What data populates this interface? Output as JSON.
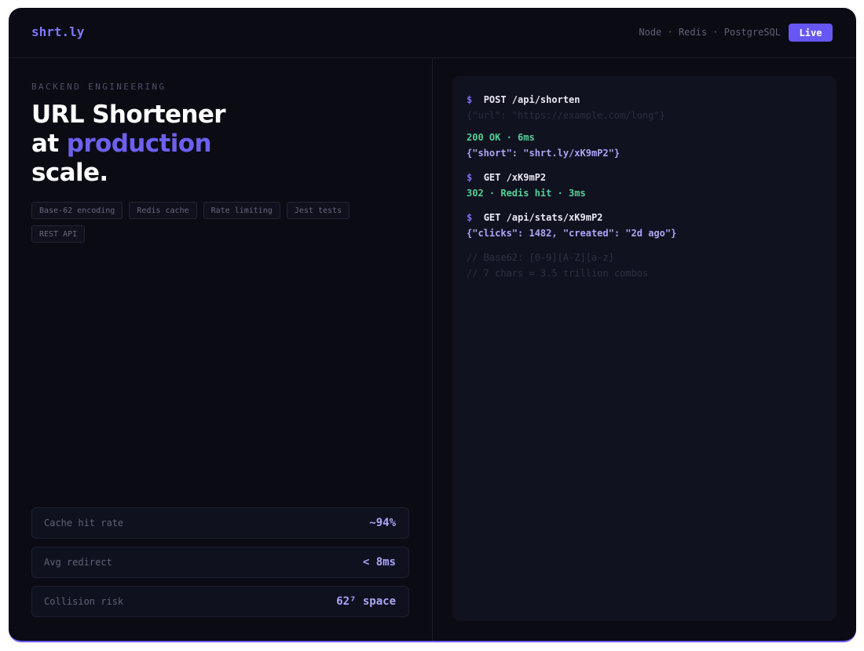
{
  "header": {
    "brand": "shrt.ly",
    "stack": "Node · Redis · PostgreSQL",
    "status_badge": "Live"
  },
  "hero": {
    "eyebrow": "BACKEND ENGINEERING",
    "title_line1": "URL Shortener",
    "title_line2_prefix": "at ",
    "title_line2_accent": "production",
    "title_line3": "scale."
  },
  "tags": [
    "Base-62 encoding",
    "Redis cache",
    "Rate limiting",
    "Jest tests",
    "REST API"
  ],
  "metrics": [
    {
      "label": "Cache hit rate",
      "value": "~94%"
    },
    {
      "label": "Avg redirect",
      "value": "< 8ms"
    },
    {
      "label": "Collision risk",
      "value": "62⁷ space"
    }
  ],
  "terminal": {
    "prompt": "$",
    "cmd1": "POST /api/shorten",
    "body1": "{\"url\": \"https://example.com/long\"}",
    "resp1_status": "200 OK · 6ms",
    "resp1_body": "{\"short\": \"shrt.ly/xK9mP2\"}",
    "cmd2": "GET /xK9mP2",
    "resp2_status": "302 · Redis hit · 3ms",
    "cmd3": "GET /api/stats/xK9mP2",
    "resp3_body": "{\"clicks\": 1482, \"created\": \"2d ago\"}",
    "comment1": "// Base62: [0-9][A-Z][a-z]",
    "comment2": "// 7 chars = 3.5 trillion combos"
  },
  "colors": {
    "accent": "#6757f2",
    "background": "#0b0b14",
    "success": "#4fd197"
  }
}
